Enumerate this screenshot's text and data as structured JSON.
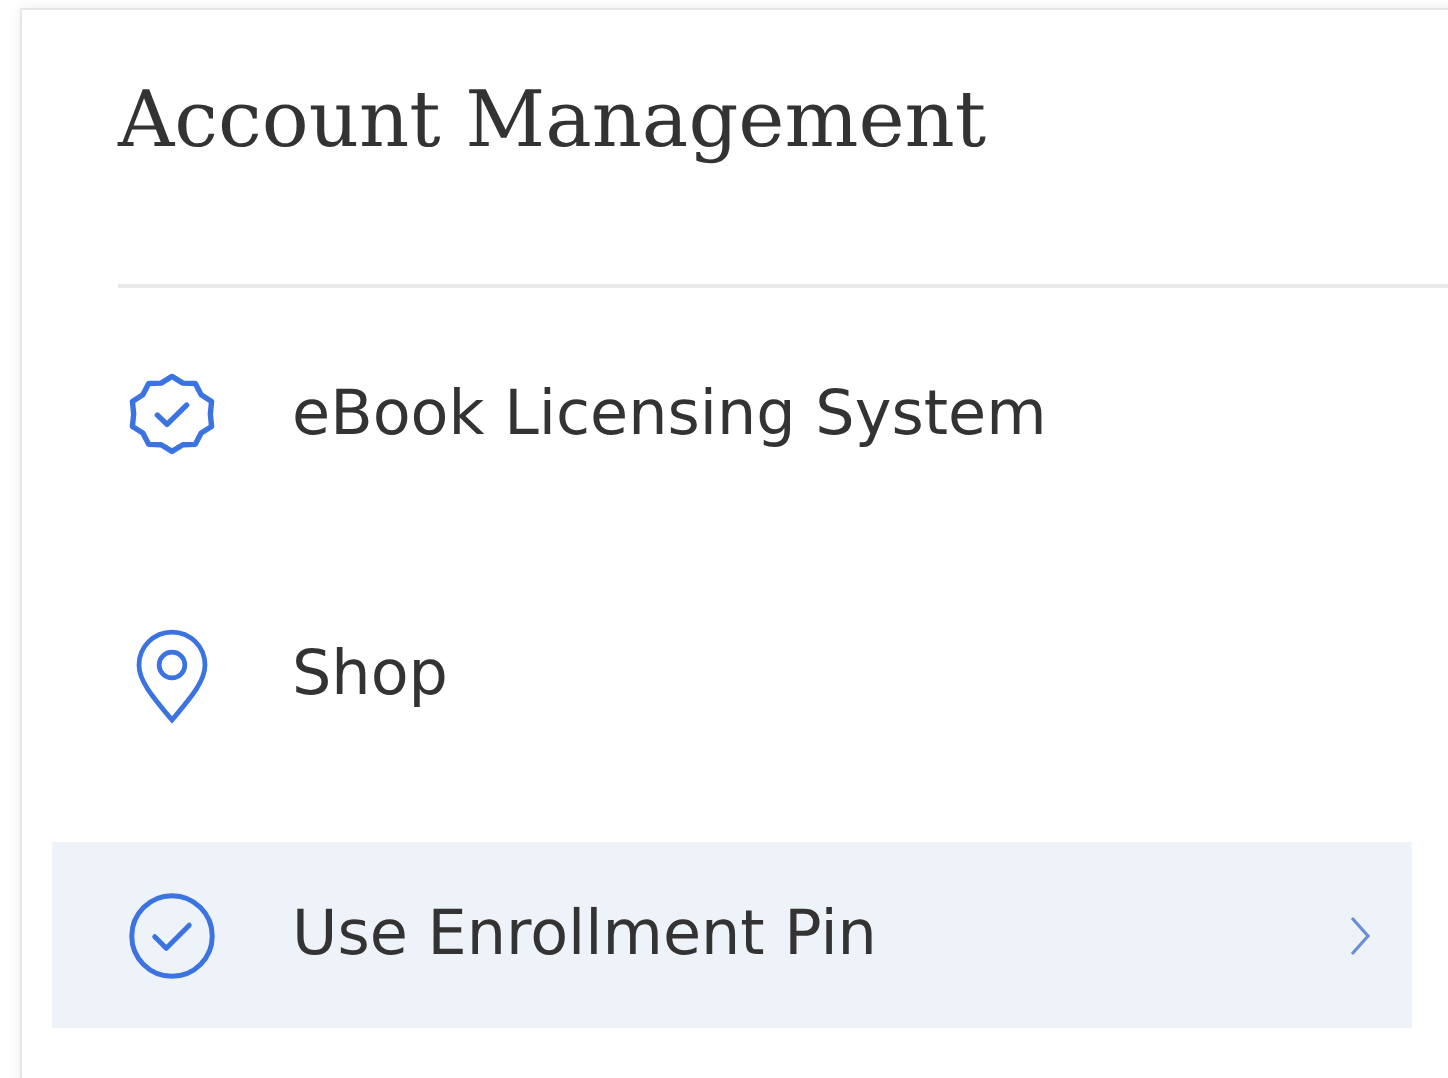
{
  "title": "Account Management",
  "items": [
    {
      "label": "eBook Licensing System",
      "selected": false
    },
    {
      "label": "Shop",
      "selected": false
    },
    {
      "label": "Use Enrollment Pin",
      "selected": true
    }
  ]
}
